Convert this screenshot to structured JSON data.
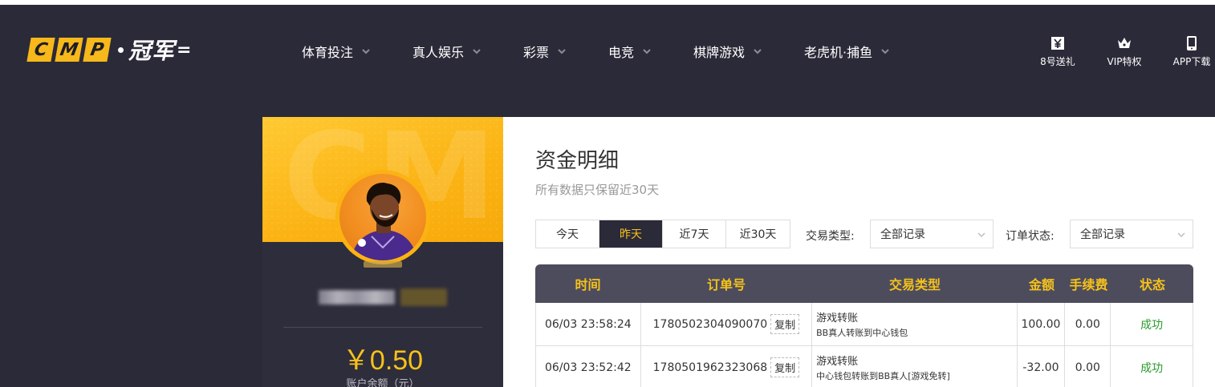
{
  "header": {
    "logo_letters": [
      "C",
      "M",
      "P"
    ],
    "logo_cn": "冠军",
    "nav": [
      {
        "label": "体育投注"
      },
      {
        "label": "真人娱乐"
      },
      {
        "label": "彩票"
      },
      {
        "label": "电竞"
      },
      {
        "label": "棋牌游戏"
      },
      {
        "label": "老虎机·捕鱼"
      }
    ],
    "top_icons": [
      {
        "label": "8号送礼",
        "icon": "yen-gift-icon"
      },
      {
        "label": "VIP特权",
        "icon": "crown-icon"
      },
      {
        "label": "APP下载",
        "icon": "phone-icon"
      }
    ]
  },
  "profile": {
    "watermark": "CMP",
    "balance": "￥0.50",
    "balance_label": "账户余额（元）"
  },
  "main": {
    "title": "资金明细",
    "subtitle": "所有数据只保留近30天",
    "tabs": [
      {
        "label": "今天",
        "active": false
      },
      {
        "label": "昨天",
        "active": true
      },
      {
        "label": "近7天",
        "active": false
      },
      {
        "label": "近30天",
        "active": false
      }
    ],
    "filters": {
      "type_label": "交易类型:",
      "type_value": "全部记录",
      "status_label": "订单状态:",
      "status_value": "全部记录"
    },
    "table": {
      "headers": [
        "时间",
        "订单号",
        "交易类型",
        "金额",
        "手续费",
        "状态"
      ],
      "copy_label": "复制",
      "rows": [
        {
          "time": "06/03 23:58:24",
          "order": "1780502304090070",
          "type": "游戏转账",
          "type_detail": "BB真人转账到中心钱包",
          "amount": "100.00",
          "fee": "0.00",
          "status": "成功"
        },
        {
          "time": "06/03 23:52:42",
          "order": "1780501962323068",
          "type": "游戏转账",
          "type_detail": "中心钱包转账到BB真人[游戏免转]",
          "amount": "-32.00",
          "fee": "0.00",
          "status": "成功"
        }
      ]
    }
  },
  "colors": {
    "header_bg": "#2b2a38",
    "accent": "#f6c21a",
    "table_head": "#4d4c5d",
    "success": "#2d9a2d"
  }
}
